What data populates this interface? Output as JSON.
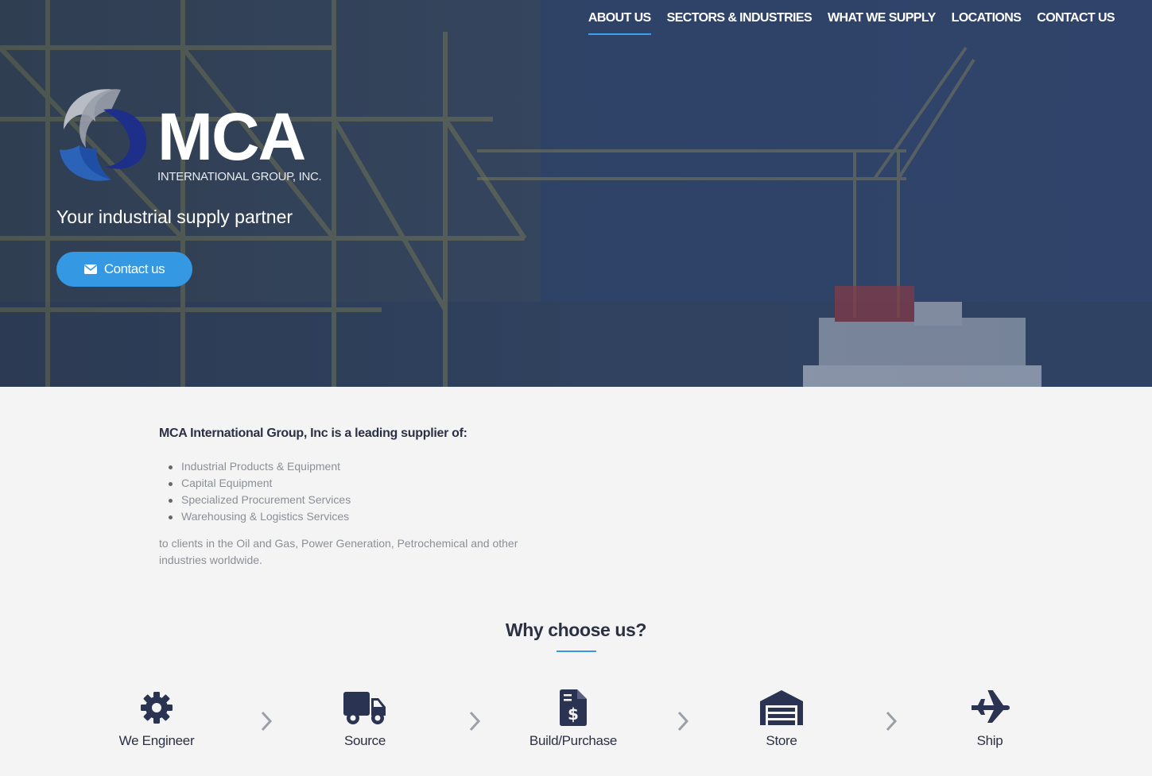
{
  "nav": {
    "items": [
      "ABOUT US",
      "SECTORS & INDUSTRIES",
      "WHAT WE SUPPLY",
      "LOCATIONS",
      "CONTACT US"
    ],
    "active": "ABOUT US"
  },
  "hero": {
    "logo_text": "MCA",
    "logo_subtext": "INTERNATIONAL GROUP, INC.",
    "tagline": "Your industrial supply partner",
    "cta_label": "Contact us"
  },
  "intro": {
    "heading": "MCA International Group, Inc is a leading supplier of:",
    "items": [
      "Industrial Products & Equipment",
      "Capital Equipment",
      "Specialized Procurement Services",
      "Warehousing & Logistics Services"
    ],
    "tail": "to clients in the Oil and Gas, Power Generation, Petrochemical and other industries worldwide."
  },
  "why": {
    "heading": "Why choose us?",
    "steps": [
      {
        "label": "We Engineer",
        "icon": "gear-icon"
      },
      {
        "label": "Source",
        "icon": "truck-icon"
      },
      {
        "label": "Build/Purchase",
        "icon": "invoice-dollar-icon"
      },
      {
        "label": "Store",
        "icon": "warehouse-icon"
      },
      {
        "label": "Ship",
        "icon": "plane-icon"
      }
    ]
  },
  "colors": {
    "accent": "#3598e3",
    "heading": "#2b3144",
    "muted_text": "#8a8f98",
    "icon": "#2b3352"
  }
}
